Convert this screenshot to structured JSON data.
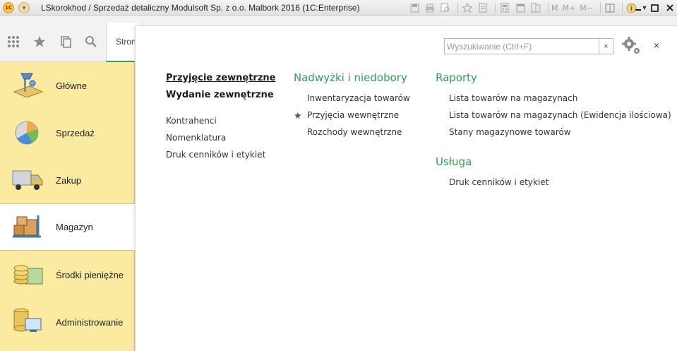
{
  "window": {
    "title": "LSkorokhod / Sprzedaż detaliczny Modulsoft Sp. z o.o. Malbork 2016  (1C:Enterprise)",
    "logo_text": "1C",
    "toolbar_m": [
      "M",
      "M+",
      "M−"
    ],
    "toolbar_icons": [
      "save-icon",
      "print-icon",
      "print-preview-icon",
      "favorites-icon",
      "page-icon",
      "calculator-icon",
      "calendar-icon",
      "compare-icon",
      "layout-icon",
      "info-icon"
    ]
  },
  "topbar": {
    "start_tab_label": "Strona początkowa",
    "icons": [
      "apps-grid-icon",
      "star-icon",
      "history-icon",
      "search-icon"
    ]
  },
  "sidebar": {
    "items": [
      {
        "label": "Główne",
        "icon": "desk-lamp-icon",
        "active": false
      },
      {
        "label": "Sprzedaż",
        "icon": "pie-chart-icon",
        "active": false
      },
      {
        "label": "Zakup",
        "icon": "truck-icon",
        "active": false
      },
      {
        "label": "Magazyn",
        "icon": "boxes-cart-icon",
        "active": true
      },
      {
        "label": "Środki pieniężne",
        "icon": "coins-icon",
        "active": false
      },
      {
        "label": "Administrowanie",
        "icon": "database-monitor-icon",
        "active": false
      }
    ]
  },
  "panel": {
    "search_placeholder": "Wyszukiwanie (Ctrl+F)",
    "search_value": "",
    "search_clear": "×",
    "close": "×",
    "col1": {
      "bold_links": [
        "Przyjęcie zewnętrzne",
        "Wydanie zewnętrzne"
      ],
      "links": [
        "Kontrahenci",
        "Nomenklatura",
        "Druk cenników i etykiet"
      ]
    },
    "col2": {
      "title": "Nadwyżki i niedobory",
      "links": [
        "Inwentaryzacja towarów",
        "Przyjęcia wewnętrzne",
        "Rozchody wewnętrzne"
      ]
    },
    "col3": {
      "group1": {
        "title": "Raporty",
        "links": [
          "Lista towarów na magazynach",
          "Lista towarów na magazynach (Ewidencja ilościowa)",
          "Stany magazynowe towarów"
        ]
      },
      "group2": {
        "title": "Usługa",
        "links": [
          "Druk cenników i etykiet"
        ]
      }
    }
  },
  "colors": {
    "sidebar_bg": "#fbeba1",
    "accent_green": "#2e9e58",
    "active_tab_underline": "#36a15c"
  }
}
